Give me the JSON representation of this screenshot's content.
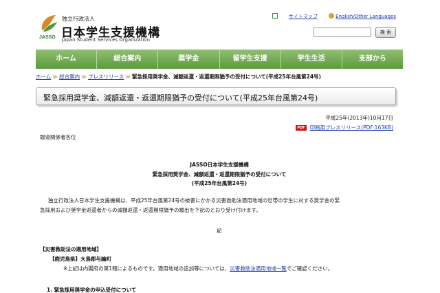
{
  "header": {
    "org_small": "独立行政法人",
    "org_name": "日本学生支援機構",
    "org_en": "Japan Student Services Organization",
    "logo_text": "JASSO",
    "sitemap_link": "サイトマップ",
    "english_link": "English/Other Languages",
    "search_placeholder": "",
    "search_button": "検 索"
  },
  "nav": {
    "items": [
      "ホーム",
      "総合案内",
      "奨学金",
      "留学生支援",
      "学生生活",
      "支部から"
    ]
  },
  "breadcrumb": {
    "home": "ホーム",
    "about": "総合案内",
    "press": "プレスリリース",
    "sep": "≫",
    "current": "緊急採用奨学金、減額返還・返還期限猶予の受付について(平成25年台風第24号)"
  },
  "title": "緊急採用奨学金、減額返還・返還期限猶予の受付について(平成25年台風第24号)",
  "date": "平成25年(2013年)10月17日",
  "pdf": {
    "badge": "PDF",
    "link": "印刷用プレスリリース(PDF:163KB)"
  },
  "addressee": "報道関係者各位",
  "body": {
    "center_line1": "JASSO日本学生支援機構",
    "center_line2": "緊急採用奨学金、減額返還・返還期限猶予の受付について",
    "center_line3": "(平成25年台風第24号)",
    "para_line1": "独立行政法人日本学生支援機構は、平成25年台風第24号の被害にかかる災害救助法適用地域の世帯の学生に対する奨学金の緊",
    "para_line2": "急採用および奨学金返還者からの減額返還・返還期限猶予の願出を下記のとおり受け付けます。",
    "ki": "記",
    "section_head": "【災害救助法の適用地域】",
    "region": "【鹿児島県】大島郡与論町",
    "note_before": "※上記は内閣府の第1報によるものです。適用地域の追加等については、",
    "note_link": "災害救助法適用地域一覧",
    "note_after": "でご確認ください。",
    "item1": "1. 緊急採用奨学金の申込受付について"
  },
  "colors": {
    "nav_green": "#6fa84c",
    "link_blue": "#1a3ab0",
    "breadcrumb_sep": "#d07a10",
    "pdf_red": "#c81818"
  },
  "icons": {
    "sitemap": "sitemap-icon",
    "english": "globe-icon",
    "logo": "jasso-leaf-logo",
    "pdf": "pdf-icon"
  }
}
